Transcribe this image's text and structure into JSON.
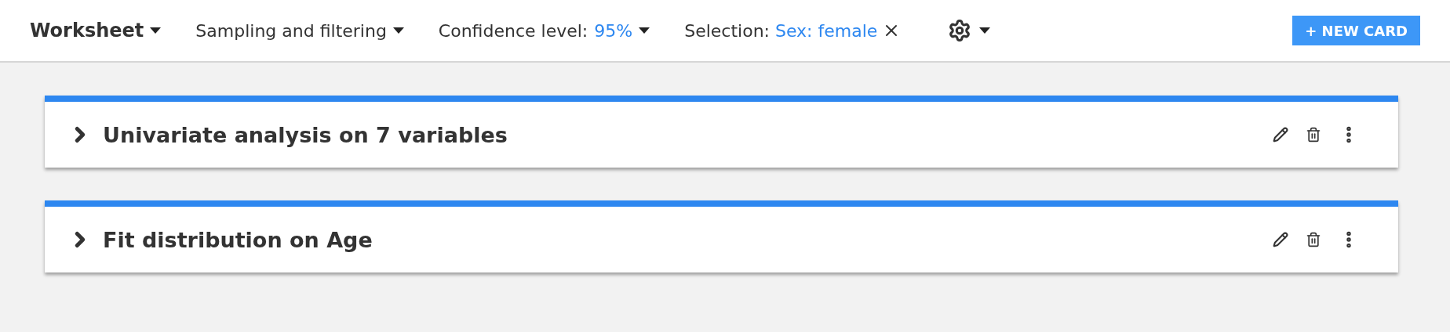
{
  "toolbar": {
    "worksheet_menu": "Worksheet",
    "sampling_menu": "Sampling and filtering",
    "confidence": {
      "label": "Confidence level:",
      "value": "95%"
    },
    "selection": {
      "label": "Selection:",
      "value": "Sex: female"
    },
    "new_card_button": "+ NEW CARD"
  },
  "cards": [
    {
      "title": "Univariate analysis on 7 variables",
      "expanded": false
    },
    {
      "title": "Fit distribution on Age",
      "expanded": false
    }
  ]
}
